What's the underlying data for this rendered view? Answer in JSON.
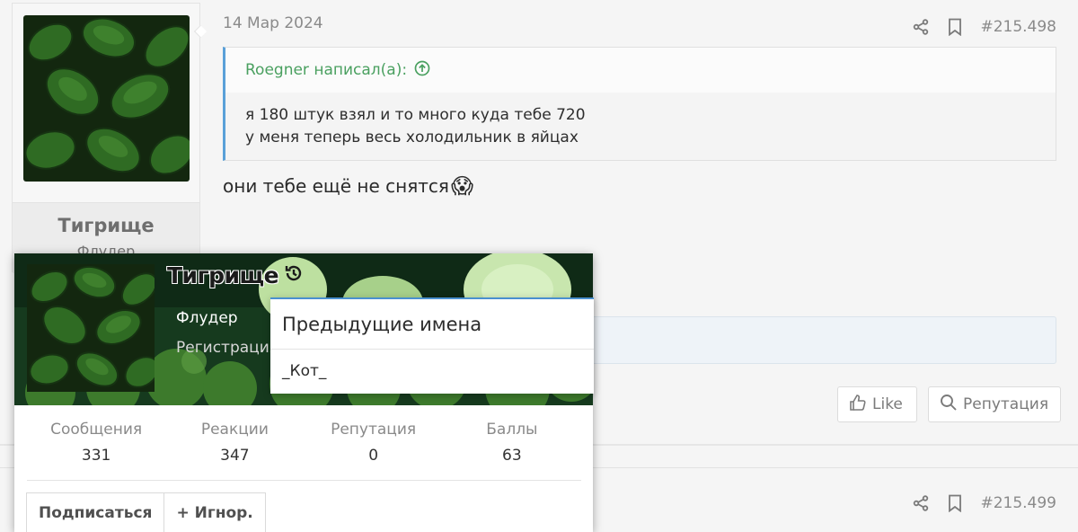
{
  "post1": {
    "author": {
      "name": "Тигрище",
      "title": "Флудер"
    },
    "date": "14 Мар 2024",
    "post_number": "#215.498",
    "quote": {
      "author_line": "Roegner написал(а):",
      "lines": [
        "я 180 штук взял и то много куда тебе 720",
        "у меня теперь весь холодильник в яйцах"
      ]
    },
    "message": "они тебе ещё не снятся",
    "emoji": "😱",
    "buttons": {
      "like": "Like",
      "reputation": "Репутация"
    }
  },
  "post2": {
    "post_number": "#215.499"
  },
  "member_card": {
    "name": "Тигрище",
    "role": "Флудер",
    "registration": "Регистрация",
    "stats": [
      {
        "label": "Сообщения",
        "value": "331"
      },
      {
        "label": "Реакции",
        "value": "347"
      },
      {
        "label": "Репутация",
        "value": "0"
      },
      {
        "label": "Баллы",
        "value": "63"
      }
    ],
    "buttons": {
      "follow": "Подписаться",
      "ignore": "+ Игнор."
    }
  },
  "previous_names": {
    "title": "Предыдущие имена",
    "items": [
      "_Кот_"
    ]
  },
  "colors": {
    "quote_border": "#5aa0d8",
    "quote_author": "#4aa060",
    "popup_accent": "#4a90d0"
  },
  "icons": [
    "share-icon",
    "bookmark-icon",
    "arrow-up-circle-icon",
    "thumbs-up-icon",
    "search-icon",
    "history-icon"
  ]
}
